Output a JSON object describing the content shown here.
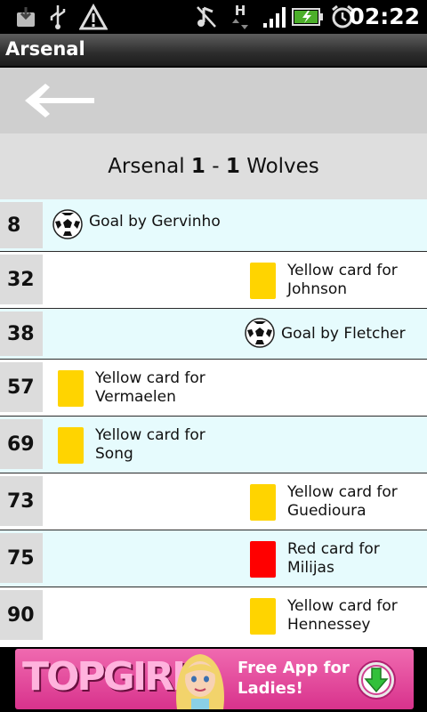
{
  "status_bar": {
    "time": "02:22",
    "network_type": "H",
    "icons": [
      "download-icon",
      "usb-icon",
      "warning-icon",
      "music-muted-icon",
      "data-arrows-icon",
      "signal-icon",
      "battery-charging-icon",
      "alarm-icon"
    ]
  },
  "title_bar": {
    "title": "Arsenal"
  },
  "back": {
    "icon": "back-arrow-icon"
  },
  "score": {
    "home_team": "Arsenal",
    "home_goals": "1",
    "separator": "-",
    "away_goals": "1",
    "away_team": "Wolves"
  },
  "events": [
    {
      "minute": "8",
      "side": "home",
      "type": "goal",
      "text": "Goal by Gervinho"
    },
    {
      "minute": "32",
      "side": "away",
      "type": "yellow",
      "text": "Yellow card for\nJohnson"
    },
    {
      "minute": "38",
      "side": "away",
      "type": "goal",
      "text": "Goal by Fletcher"
    },
    {
      "minute": "57",
      "side": "home",
      "type": "yellow",
      "text": "Yellow card for\nVermaelen"
    },
    {
      "minute": "69",
      "side": "home",
      "type": "yellow",
      "text": "Yellow card for\nSong"
    },
    {
      "minute": "73",
      "side": "away",
      "type": "yellow",
      "text": "Yellow card for\nGuedioura"
    },
    {
      "minute": "75",
      "side": "away",
      "type": "red",
      "text": "Red card for\nMilijas"
    },
    {
      "minute": "90",
      "side": "away",
      "type": "yellow",
      "text": "Yellow card for\nHennessey"
    }
  ],
  "ad": {
    "brand": "TOPGIRL",
    "cta": "Free App for\nLadies!",
    "icon": "download-arrow-icon"
  },
  "colors": {
    "yellow_card": "#ffd400",
    "red_card": "#ff0000",
    "row_alt": "#e6fbfd",
    "minute_bg": "#dcdcdc"
  }
}
